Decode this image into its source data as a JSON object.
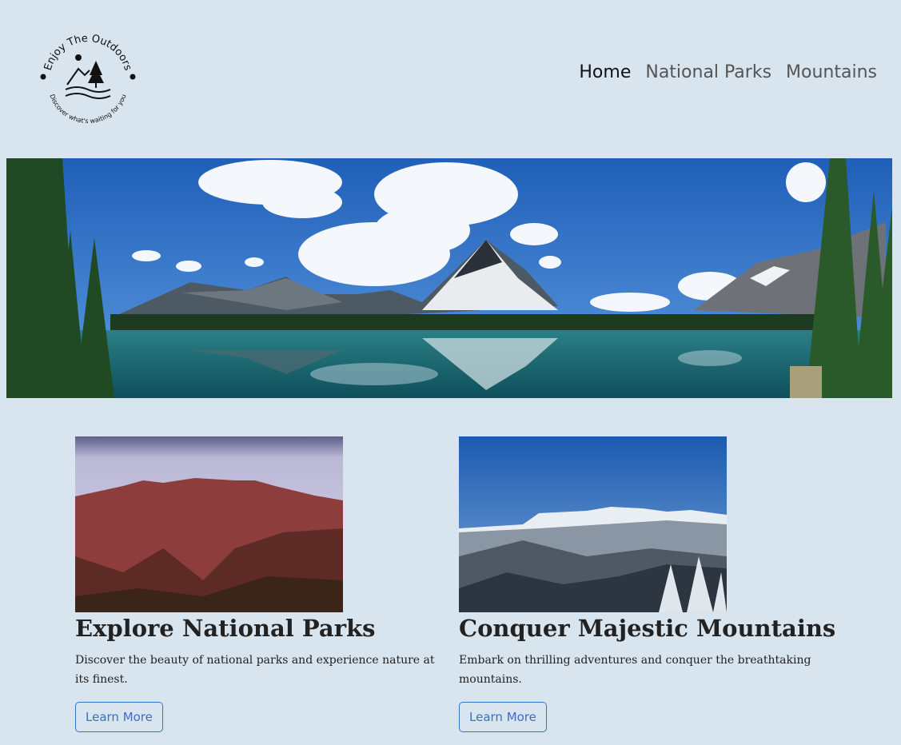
{
  "logo": {
    "top_text": "Enjoy The Outdoors",
    "bottom_text": "Discover what's waiting for you"
  },
  "nav": {
    "items": [
      {
        "label": "Home",
        "active": true
      },
      {
        "label": "National Parks",
        "active": false
      },
      {
        "label": "Mountains",
        "active": false
      }
    ]
  },
  "cards": [
    {
      "title": "Explore National Parks",
      "text": "Discover the beauty of national parks and experience nature at its finest.",
      "button": "Learn More"
    },
    {
      "title": "Conquer Majestic Mountains",
      "text": "Embark on thrilling adventures and conquer the breathtaking mountains.",
      "button": "Learn More"
    }
  ],
  "colors": {
    "background": "#d8e4ee",
    "button_accent": "#3b6fc4",
    "nav_active": "#111111",
    "nav_inactive": "#555555"
  }
}
